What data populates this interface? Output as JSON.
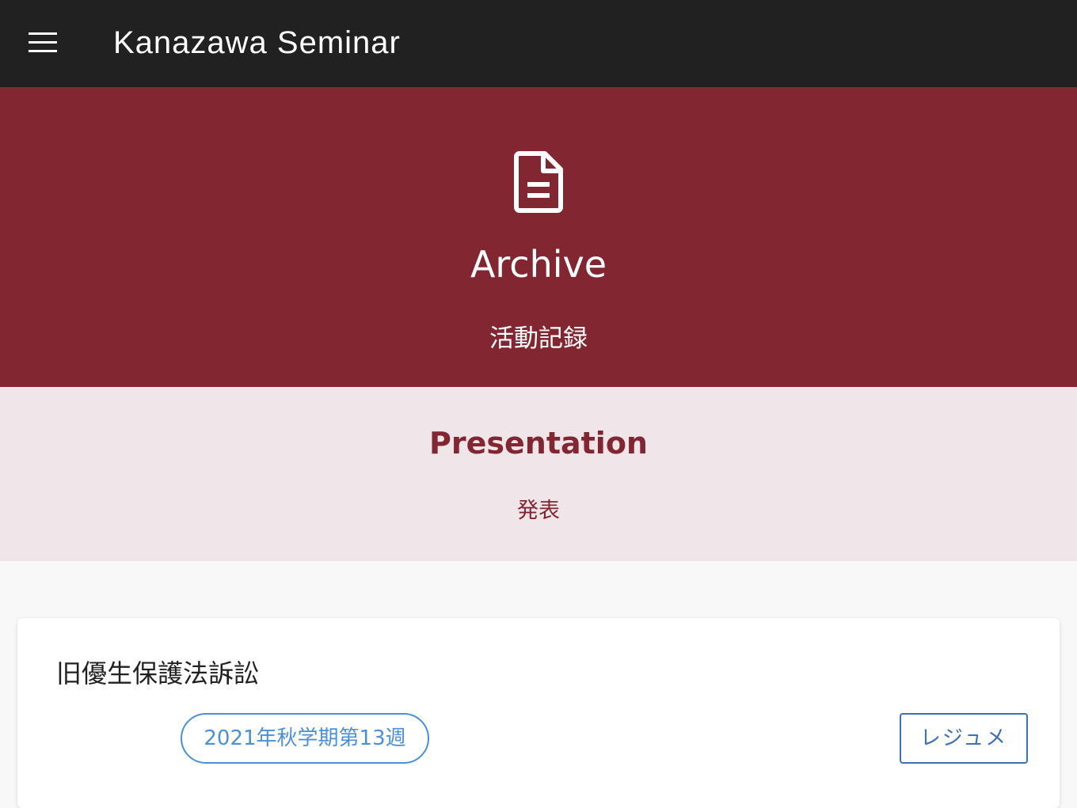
{
  "header": {
    "site_title": "Kanazawa Seminar",
    "menu_icon": "hamburger-menu-icon"
  },
  "hero": {
    "icon": "document-icon",
    "title": "Archive",
    "subtitle": "活動記録"
  },
  "section": {
    "title": "Presentation",
    "subtitle": "発表"
  },
  "card": {
    "title": "旧優生保護法訴訟",
    "tag_label": "2021年秋学期第13週",
    "resume_label": "レジュメ"
  },
  "colors": {
    "topbar": "#212121",
    "brand": "#822732",
    "band": "#f0e5e8",
    "chip": "#4a90d9",
    "button": "#3f6fb5"
  }
}
